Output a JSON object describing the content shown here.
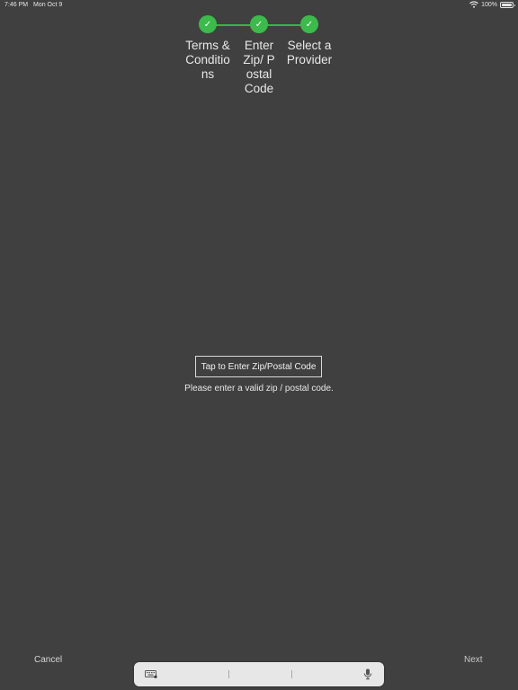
{
  "status_bar": {
    "time": "7:46 PM",
    "date": "Mon Oct 9",
    "battery_text": "100%",
    "icons": [
      "wifi-icon",
      "battery-icon"
    ]
  },
  "stepper": {
    "accent_color": "#3cba4c",
    "steps": [
      {
        "label": "Terms & Conditions",
        "check": "✓",
        "complete": true
      },
      {
        "label": "Enter Zip/ Postal Code",
        "check": "✓",
        "complete": true
      },
      {
        "label": "Select a Provider",
        "check": "✓",
        "complete": true
      }
    ]
  },
  "zip": {
    "button_label": "Tap to Enter Zip/Postal Code",
    "hint": "Please enter a valid zip / postal code."
  },
  "footer": {
    "cancel_label": "Cancel",
    "next_label": "Next"
  },
  "keyboard_bar": {
    "icons": [
      "keyboard-icon",
      "microphone-icon"
    ]
  }
}
